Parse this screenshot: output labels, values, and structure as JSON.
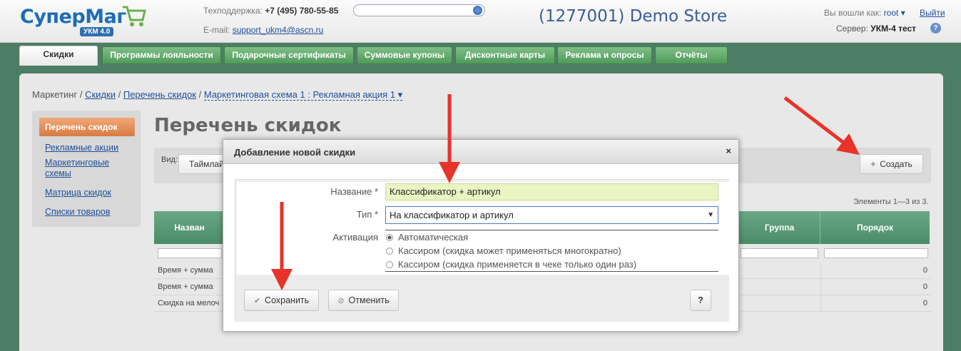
{
  "header": {
    "logo_text": "СуперМаг",
    "logo_badge": "УКМ 4.0",
    "support_label": "Техподдержка:",
    "support_phone": "+7 (495) 780-55-85",
    "email_label": "E-mail:",
    "email": "support_ukm4@ascn.ru",
    "store_title": "(1277001) Demo Store",
    "logged_as_label": "Вы вошли как:",
    "user": "root",
    "logout": "Выйти",
    "server_label": "Сервер:",
    "server_value": "УКМ-4 тест",
    "help": "?"
  },
  "tabs": [
    {
      "label": "Скидки",
      "active": true
    },
    {
      "label": "Программы лояльности"
    },
    {
      "label": "Подарочные сертификаты"
    },
    {
      "label": "Суммовые купоны"
    },
    {
      "label": "Дисконтные карты"
    },
    {
      "label": "Реклама и опросы"
    },
    {
      "label": "Отчёты"
    }
  ],
  "breadcrumb": {
    "root": "Маркетинг",
    "items": [
      "Скидки",
      "Перечень скидок"
    ],
    "current": "Маркетинговая схема 1 : Рекламная акция 1",
    "sep": "/"
  },
  "sidebar": {
    "active": "Перечень скидок",
    "links": [
      "Рекламные акции",
      "Маркетинговые схемы",
      "Матрица скидок",
      "Списки товаров"
    ]
  },
  "page_title": "Перечень скидок",
  "toolbar": {
    "view_label": "Вид:",
    "view_value": "Таймлай",
    "create_label": "Создать",
    "create_icon": "+"
  },
  "elements_count": "Элементы 1—3 из 3.",
  "table": {
    "headers": {
      "name": "Назван",
      "group": "Группа",
      "order": "Порядок"
    },
    "rows": [
      {
        "name": "Время + сумма",
        "order": "0"
      },
      {
        "name": "Время + сумма",
        "order": "0"
      },
      {
        "name": "Скидка на мелоч",
        "order": "0"
      }
    ]
  },
  "modal": {
    "title": "Добавление новой скидки",
    "close": "×",
    "name_label": "Название *",
    "name_value": "Классификатор + артикул",
    "type_label": "Тип *",
    "type_value": "На классификатор и артикул",
    "type_arrow": "▼",
    "activation_label": "Активация",
    "activation_options": [
      {
        "label": "Автоматическая",
        "selected": true
      },
      {
        "label": "Кассиром (скидка может применяться многократно)",
        "selected": false
      },
      {
        "label": "Кассиром (скидка применяется в чеке только один раз)",
        "selected": false
      }
    ],
    "save_label": "Сохранить",
    "save_icon": "✔",
    "cancel_label": "Отменить",
    "cancel_icon": "⊘",
    "help": "?"
  },
  "colors": {
    "brand_green": "#4e7d66",
    "tab_green": "#5fa56a",
    "sidebar_active": "#e08a52",
    "name_input_bg": "#eaf5c4",
    "arrow_red": "#e8332a"
  }
}
